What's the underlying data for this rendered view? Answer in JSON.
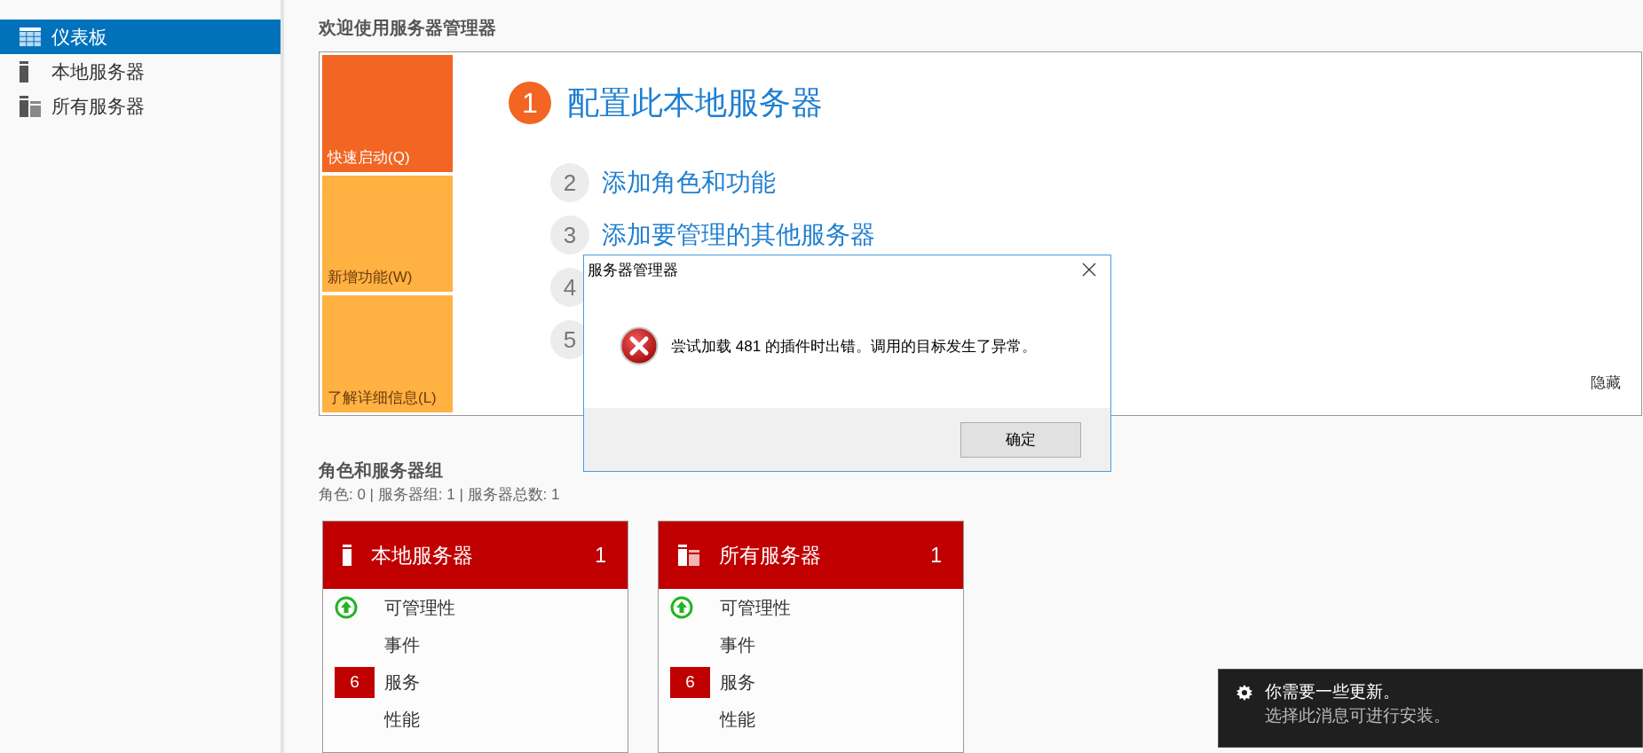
{
  "sidebar": {
    "items": [
      {
        "label": "仪表板",
        "kind": "dashboard",
        "selected": true
      },
      {
        "label": "本地服务器",
        "kind": "server",
        "selected": false
      },
      {
        "label": "所有服务器",
        "kind": "servers",
        "selected": false
      }
    ]
  },
  "welcome": {
    "title": "欢迎使用服务器管理器",
    "tiles": [
      {
        "label": "快速启动(Q)",
        "selected": true
      },
      {
        "label": "新增功能(W)",
        "selected": false
      },
      {
        "label": "了解详细信息(L)",
        "selected": false
      }
    ],
    "steps": [
      {
        "number": "1",
        "label": "配置此本地服务器",
        "selected": true
      },
      {
        "number": "2",
        "label": "添加角色和功能",
        "selected": false
      },
      {
        "number": "3",
        "label": "添加要管理的其他服务器",
        "selected": false
      },
      {
        "number": "4",
        "selected": false
      },
      {
        "number": "5",
        "selected": false
      }
    ],
    "hide_link": "隐藏"
  },
  "roles": {
    "title": "角色和服务器组",
    "summary": "角色: 0 | 服务器组: 1 | 服务器总数: 1",
    "cards": [
      {
        "title": "本地服务器",
        "kind": "server",
        "count": "1",
        "rows": [
          {
            "kind": "ok",
            "label": "可管理性"
          },
          {
            "kind": "plain",
            "label": "事件"
          },
          {
            "kind": "alert",
            "badge": "6",
            "label": "服务"
          },
          {
            "kind": "plain",
            "label": "性能"
          }
        ]
      },
      {
        "title": "所有服务器",
        "kind": "servers",
        "count": "1",
        "rows": [
          {
            "kind": "ok",
            "label": "可管理性"
          },
          {
            "kind": "plain",
            "label": "事件"
          },
          {
            "kind": "alert",
            "badge": "6",
            "label": "服务"
          },
          {
            "kind": "plain",
            "label": "性能"
          }
        ]
      }
    ]
  },
  "dialog": {
    "title": "服务器管理器",
    "kind": "error",
    "message": "尝试加载 481 的插件时出错。调用的目标发生了异常。",
    "button": "确定"
  },
  "notification": {
    "title": "你需要一些更新。",
    "message": "选择此消息可进行安装。"
  }
}
